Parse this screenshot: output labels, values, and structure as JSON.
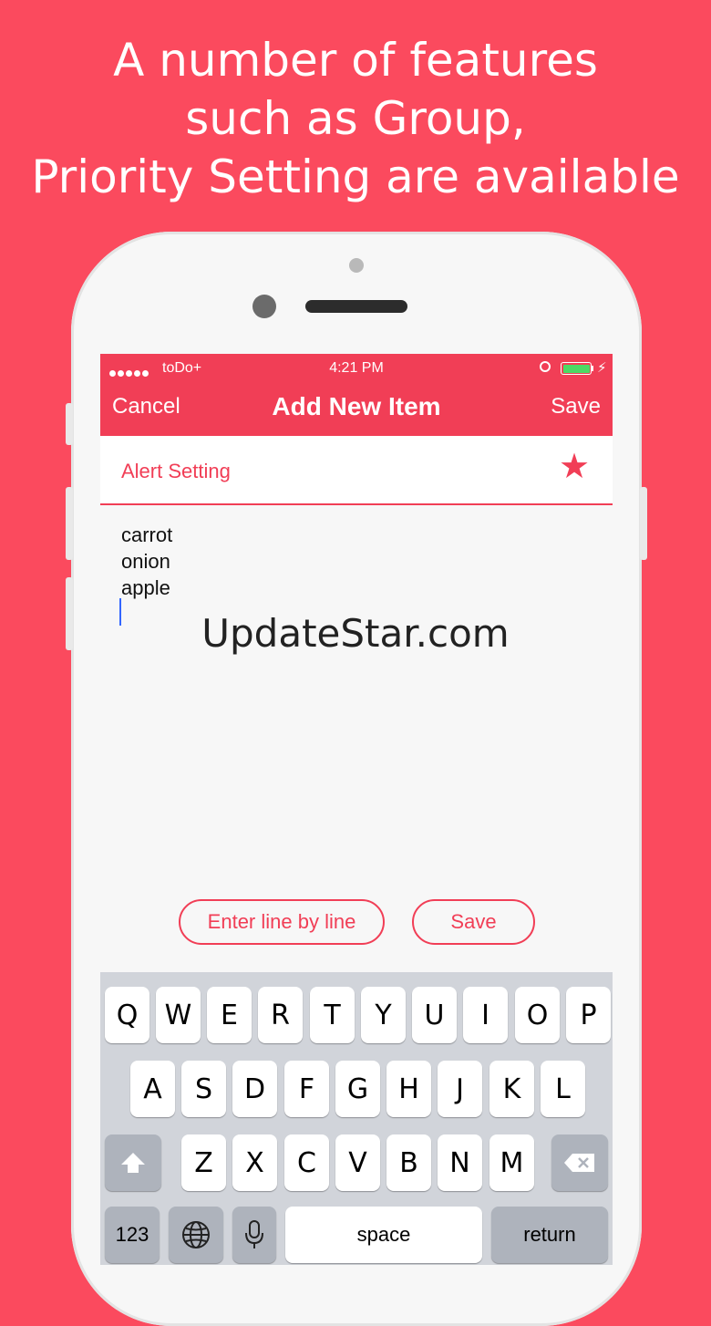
{
  "headline": [
    "A number of features",
    "such as Group,",
    "Priority Setting are available"
  ],
  "status_bar": {
    "carrier": "toDo+",
    "time": "4:21 PM"
  },
  "nav": {
    "cancel": "Cancel",
    "title": "Add New Item",
    "save": "Save"
  },
  "alert_setting": {
    "label": "Alert Setting",
    "star_icon": "star-icon"
  },
  "note_lines": [
    "carrot",
    "onion",
    "apple"
  ],
  "watermark": "UpdateStar.com",
  "actions": {
    "enter_line_by_line": "Enter line by line",
    "save": "Save"
  },
  "keyboard": {
    "row1": [
      "Q",
      "W",
      "E",
      "R",
      "T",
      "Y",
      "U",
      "I",
      "O",
      "P"
    ],
    "row2": [
      "A",
      "S",
      "D",
      "F",
      "G",
      "H",
      "J",
      "K",
      "L"
    ],
    "row3": [
      "Z",
      "X",
      "C",
      "V",
      "B",
      "N",
      "M"
    ],
    "numbers": "123",
    "space": "space",
    "return": "return"
  },
  "colors": {
    "background": "#fb4a5e",
    "accent": "#f13e56",
    "battery": "#4cd964"
  }
}
